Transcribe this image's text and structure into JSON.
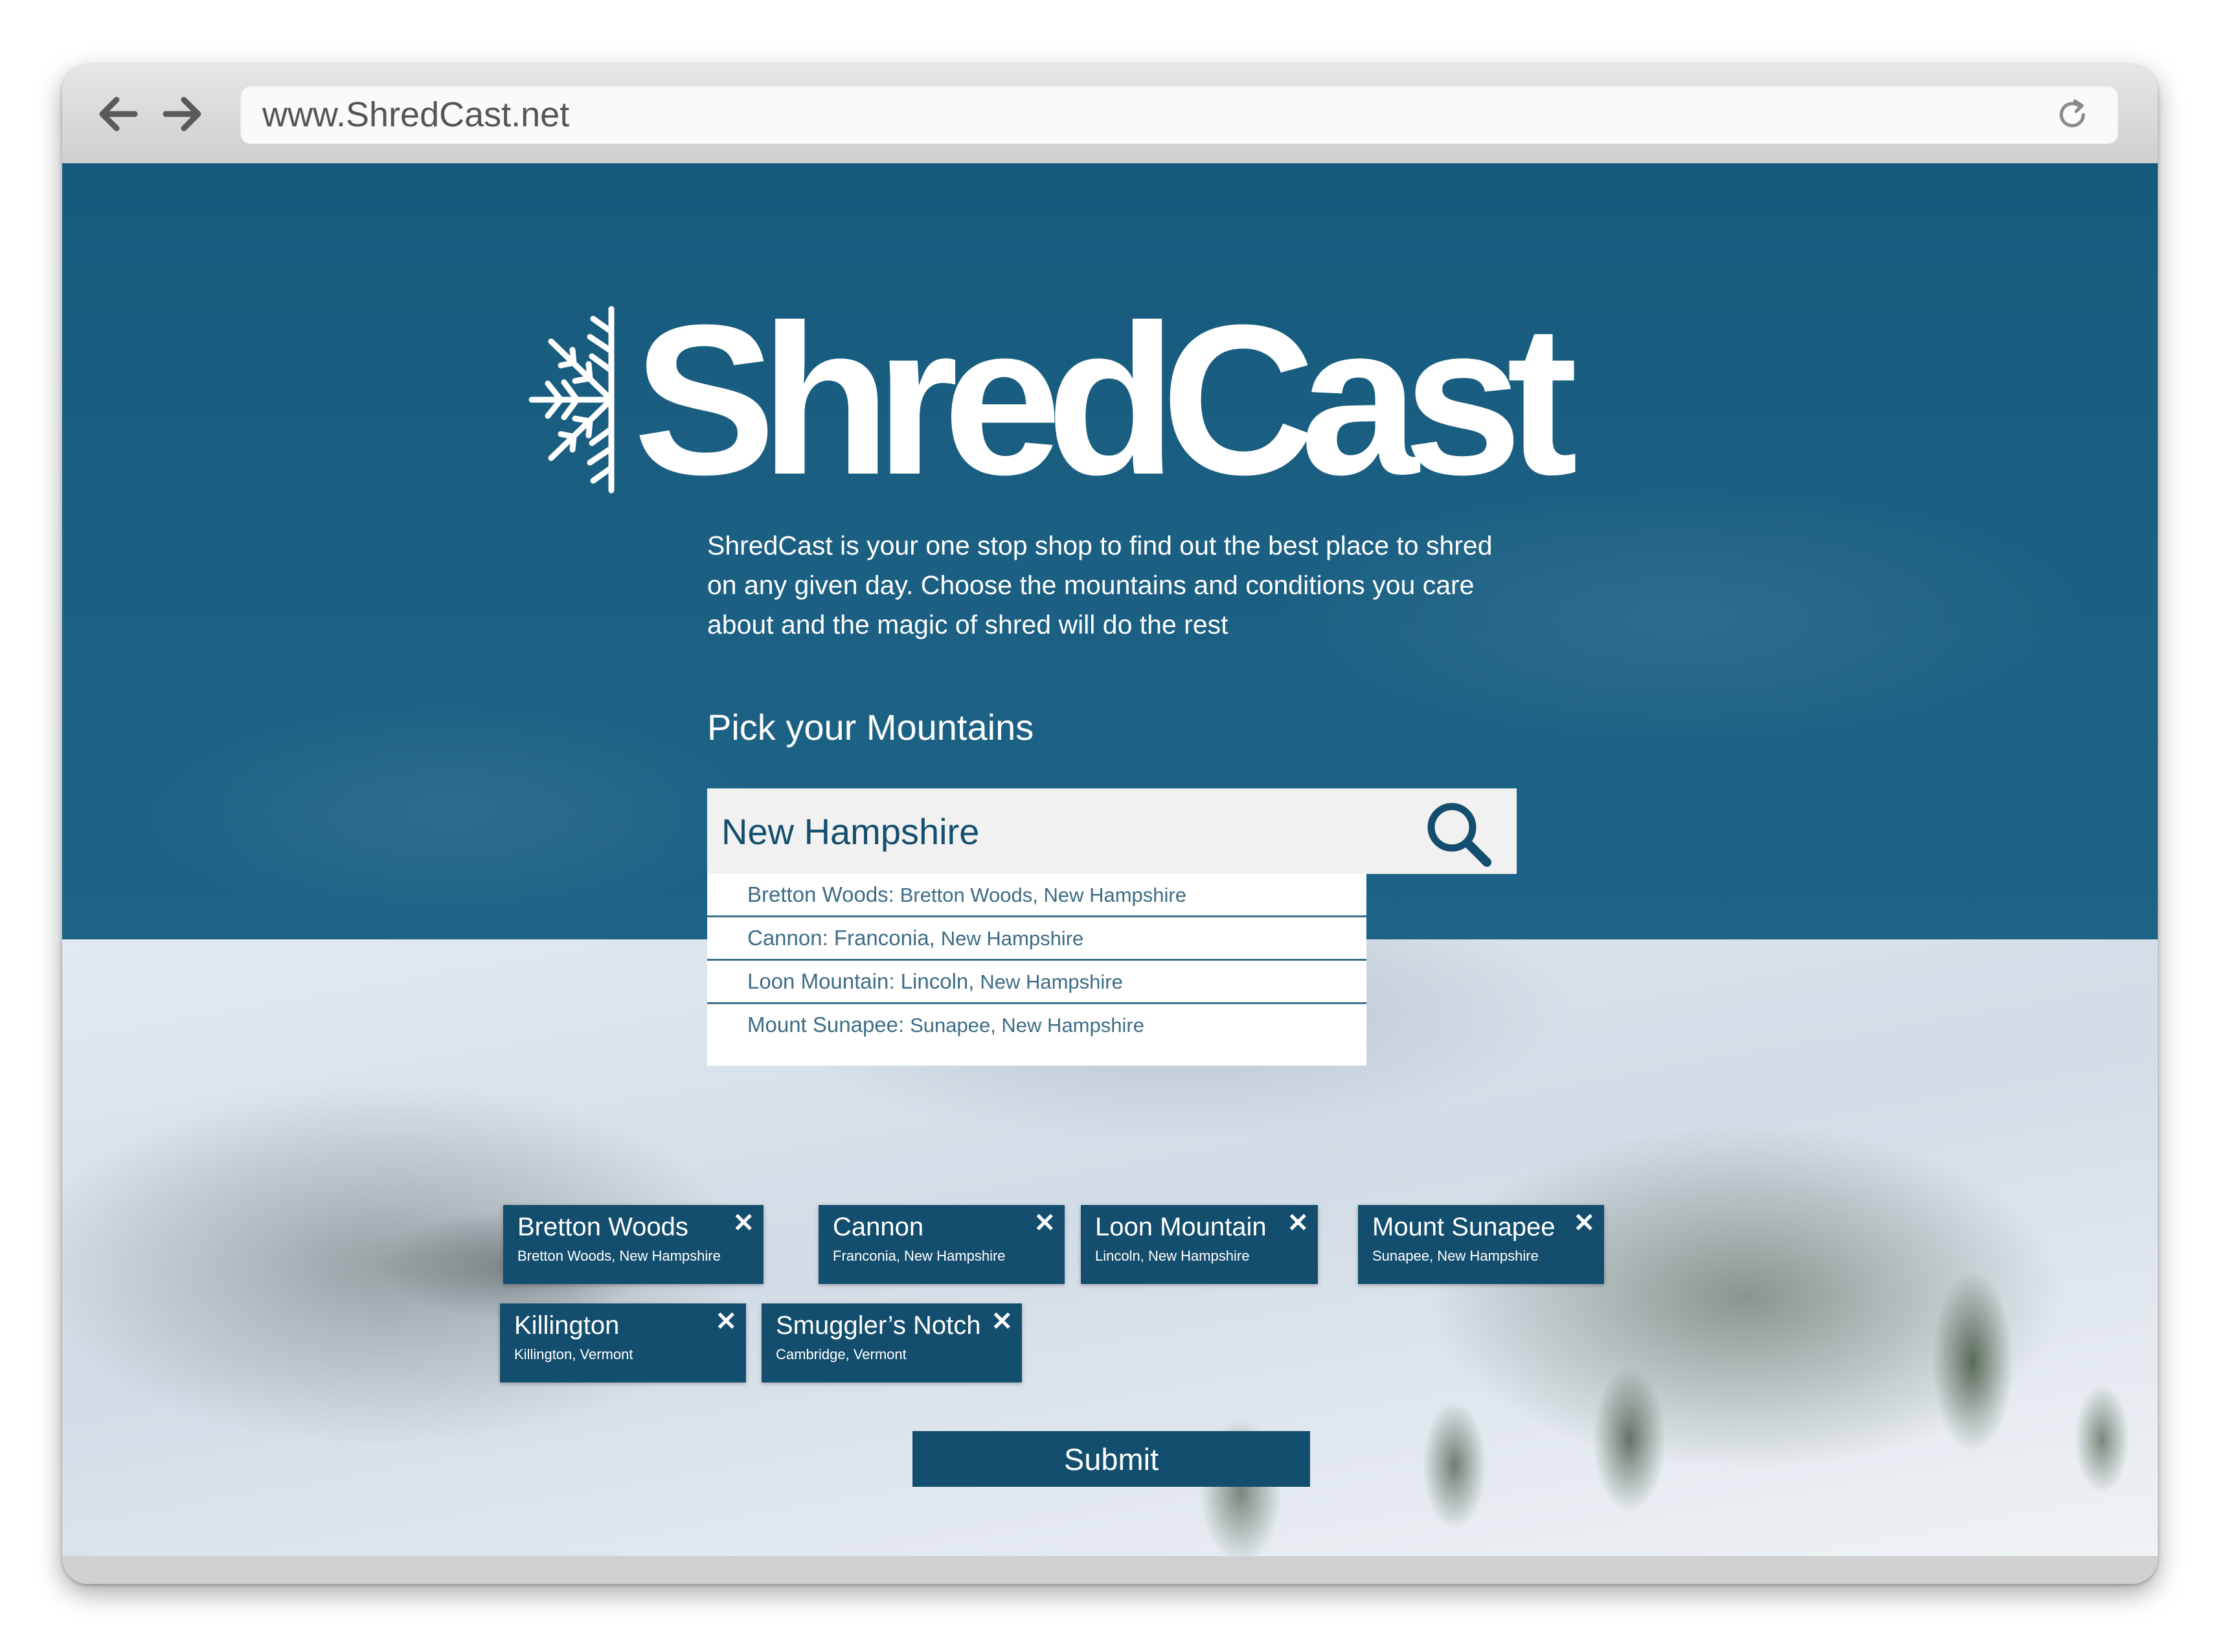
{
  "browser": {
    "url": "www.ShredCast.net",
    "back_icon": "arrow-left-icon",
    "forward_icon": "arrow-right-icon",
    "reload_icon": "reload-icon"
  },
  "logo": {
    "text": "ShredCast",
    "icon": "snowflake-icon"
  },
  "intro": {
    "description": "ShredCast is your one stop shop to find out the best place to shred on any given day. Choose the mountains and conditions you care about and the magic of shred will do the rest"
  },
  "picker": {
    "title": "Pick your Mountains",
    "search_value": "New Hampshire",
    "search_icon": "search-icon",
    "suggestions": [
      {
        "name": "Bretton Woods:",
        "location": "Bretton Woods, New Hampshire"
      },
      {
        "name": "Cannon: Franconia,",
        "location": "New Hampshire"
      },
      {
        "name": "Loon Mountain: Lincoln,",
        "location": "New Hampshire"
      },
      {
        "name": "Mount Sunapee:",
        "location": "Sunapee, New Hampshire"
      }
    ]
  },
  "selected": [
    {
      "name": "Bretton Woods",
      "location": "Bretton Woods, New Hampshire"
    },
    {
      "name": "Cannon",
      "location": "Franconia, New Hampshire"
    },
    {
      "name": "Loon Mountain",
      "location": "Lincoln, New Hampshire"
    },
    {
      "name": "Mount Sunapee",
      "location": "Sunapee, New Hampshire"
    },
    {
      "name": "Killington",
      "location": "Killington, Vermont"
    },
    {
      "name": "Smuggler’s Notch",
      "location": "Cambridge, Vermont"
    }
  ],
  "chip_remove_glyph": "✕",
  "submit_label": "Submit",
  "colors": {
    "primary": "#144e6e",
    "banner": "#1b6083"
  }
}
